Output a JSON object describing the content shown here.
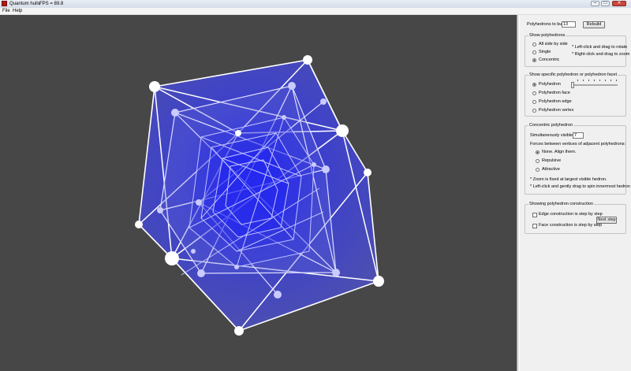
{
  "window": {
    "title": "Quantum hulls",
    "fps_label": "FPS = 89.8",
    "minimize_glyph": "–",
    "maximize_glyph": "□",
    "close_glyph": "✕"
  },
  "menu": {
    "items": [
      "File",
      "Help"
    ]
  },
  "colors": {
    "viewport_bg": "#474747",
    "hull_fill": "#4c50c8",
    "hull_edge": "#ffffff",
    "accent_blue": "#1b20e6"
  },
  "build": {
    "label": "Polyhedrons to build:",
    "value": "13",
    "rebuild_button": "Rebuild"
  },
  "show_polyhedrons": {
    "title": "Show polyhedrons",
    "options": [
      "All side by side",
      "Single",
      "Concentric"
    ],
    "selected": "Concentric",
    "hints": [
      "* Left-click and drag to rotate",
      "* Right-click and drag to zoom"
    ]
  },
  "show_specific": {
    "title": "Show specific polyhedron or polyhedron facet",
    "options": [
      "Polyhedron",
      "Polyhedron face",
      "Polyhedron edge",
      "Polyhedron vertex"
    ],
    "selected": "Polyhedron",
    "slider_level": 0
  },
  "concentric": {
    "title": "Concentric polyhedron",
    "visible_label": "Simultaneously visible:",
    "visible_value": "7",
    "forces_label": "Forces between vertices of adjacent polyhedrons:",
    "force_options": [
      "None.  Align them.",
      "Repulsive",
      "Attractive"
    ],
    "selected": "None.  Align them.",
    "notes": [
      "* Zoom is fixed at largest visible hedron.",
      "* Left-click and gently drag to spin innermost hedron"
    ]
  },
  "construction": {
    "title": "Showing polyhedron construction",
    "edge_label": "Edge construction is step by step",
    "face_label": "Face construction is step by step",
    "next_button": "Next step"
  }
}
